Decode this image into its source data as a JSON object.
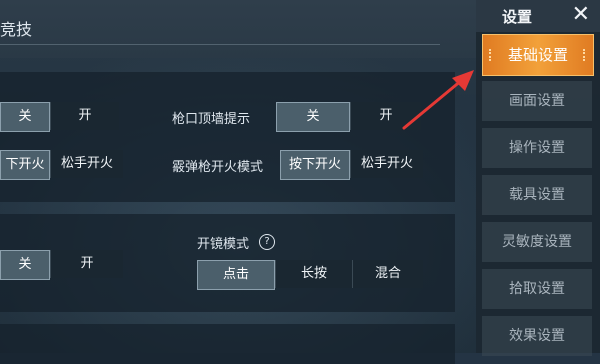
{
  "header": {
    "title_partial": "竞技"
  },
  "section1": {
    "row1_left": {
      "options": [
        "关",
        "开"
      ]
    },
    "row1_right": {
      "label": "枪口顶墙提示",
      "options": [
        "关",
        "开"
      ]
    },
    "row2_left": {
      "options": [
        "下开火",
        "松手开火"
      ]
    },
    "row2_right": {
      "label": "霰弹枪开火模式",
      "options": [
        "按下开火",
        "松手开火"
      ]
    }
  },
  "section2": {
    "row1_left": {
      "options": [
        "关",
        "开"
      ]
    },
    "scope_mode": {
      "label": "开镜模式",
      "help": "?",
      "options": [
        "点击",
        "长按",
        "混合"
      ]
    }
  },
  "sidebar": {
    "title": "设置",
    "close": "✕",
    "items": [
      {
        "label": "基础设置",
        "active": true
      },
      {
        "label": "画面设置"
      },
      {
        "label": "操作设置"
      },
      {
        "label": "载具设置"
      },
      {
        "label": "灵敏度设置"
      },
      {
        "label": "拾取设置"
      },
      {
        "label": "效果设置"
      }
    ]
  },
  "colors": {
    "accent": "#f2a13a",
    "arrow": "#e53935"
  }
}
